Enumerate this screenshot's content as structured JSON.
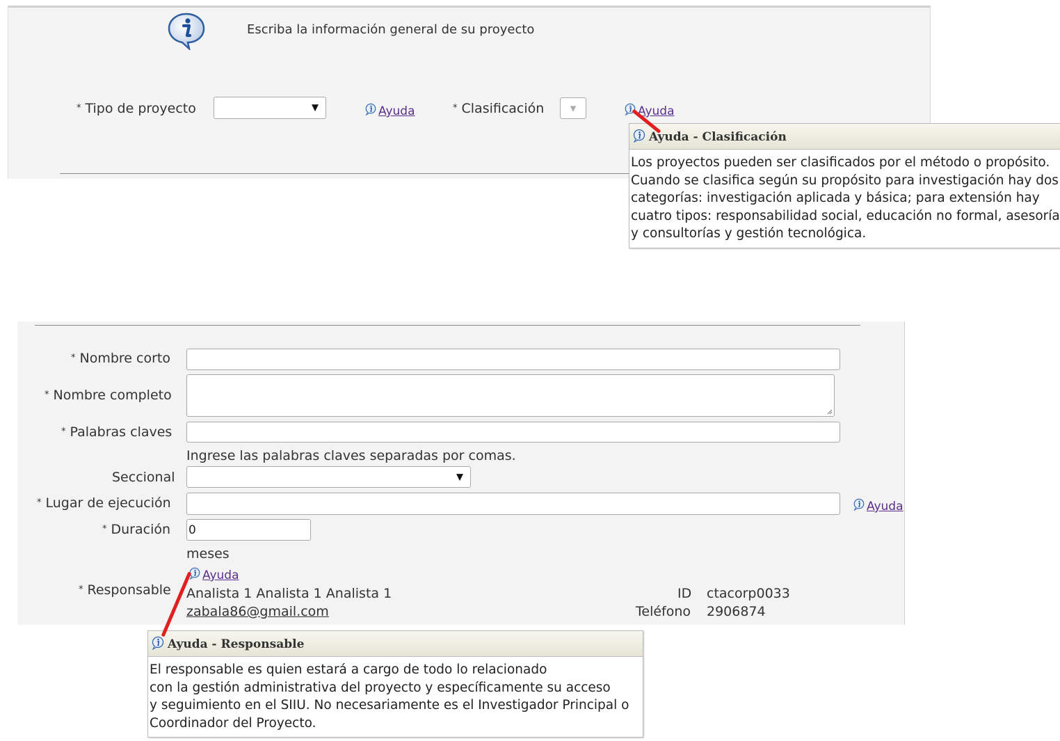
{
  "intro": "Escriba la información general de su proyecto",
  "form_top": {
    "tipo_label": "Tipo de proyecto",
    "clasificacion_label": "Clasificación",
    "help_label": "Ayuda"
  },
  "tooltip_clasificacion": {
    "title": "Ayuda - Clasificación",
    "body": "Los proyectos pueden ser clasificados por el método o propósito.\nCuando se clasifica según su propósito para investigación hay dos\ncategorías: investigación aplicada y básica; para extensión hay\ncuatro tipos: responsabilidad social, educación no formal, asesoría\ny consultorías y gestión tecnológica."
  },
  "form_bottom": {
    "nombre_corto_label": "Nombre corto",
    "nombre_completo_label": "Nombre completo",
    "palabras_label": "Palabras claves",
    "palabras_hint": "Ingrese las palabras claves separadas por comas.",
    "seccional_label": "Seccional",
    "lugar_label": "Lugar de ejecución",
    "duracion_label": "Duración",
    "duracion_value": "0",
    "duracion_unit": "meses",
    "responsable_label": "Responsable",
    "responsable_name": "Analista 1 Analista 1 Analista 1",
    "responsable_email": "zabala86@gmail.com",
    "id_label": "ID",
    "id_value": "ctacorp0033",
    "telefono_label": "Teléfono",
    "telefono_value": "2906874",
    "help_label": "Ayuda"
  },
  "tooltip_responsable": {
    "title": "Ayuda - Responsable",
    "body": "El responsable es quien estará a cargo de todo lo relacionado\ncon la gestión administrativa del proyecto y específicamente su acceso\ny seguimiento en el SIIU. No necesariamente es el Investigador Principal o\nCoordinador del Proyecto."
  },
  "colors": {
    "link": "#5a2e8c",
    "annotation_arrow": "#e21f1f",
    "info_icon": "#2f67b3"
  },
  "icons": [
    "info-icon",
    "dropdown-arrow-icon",
    "resize-grip-icon"
  ]
}
